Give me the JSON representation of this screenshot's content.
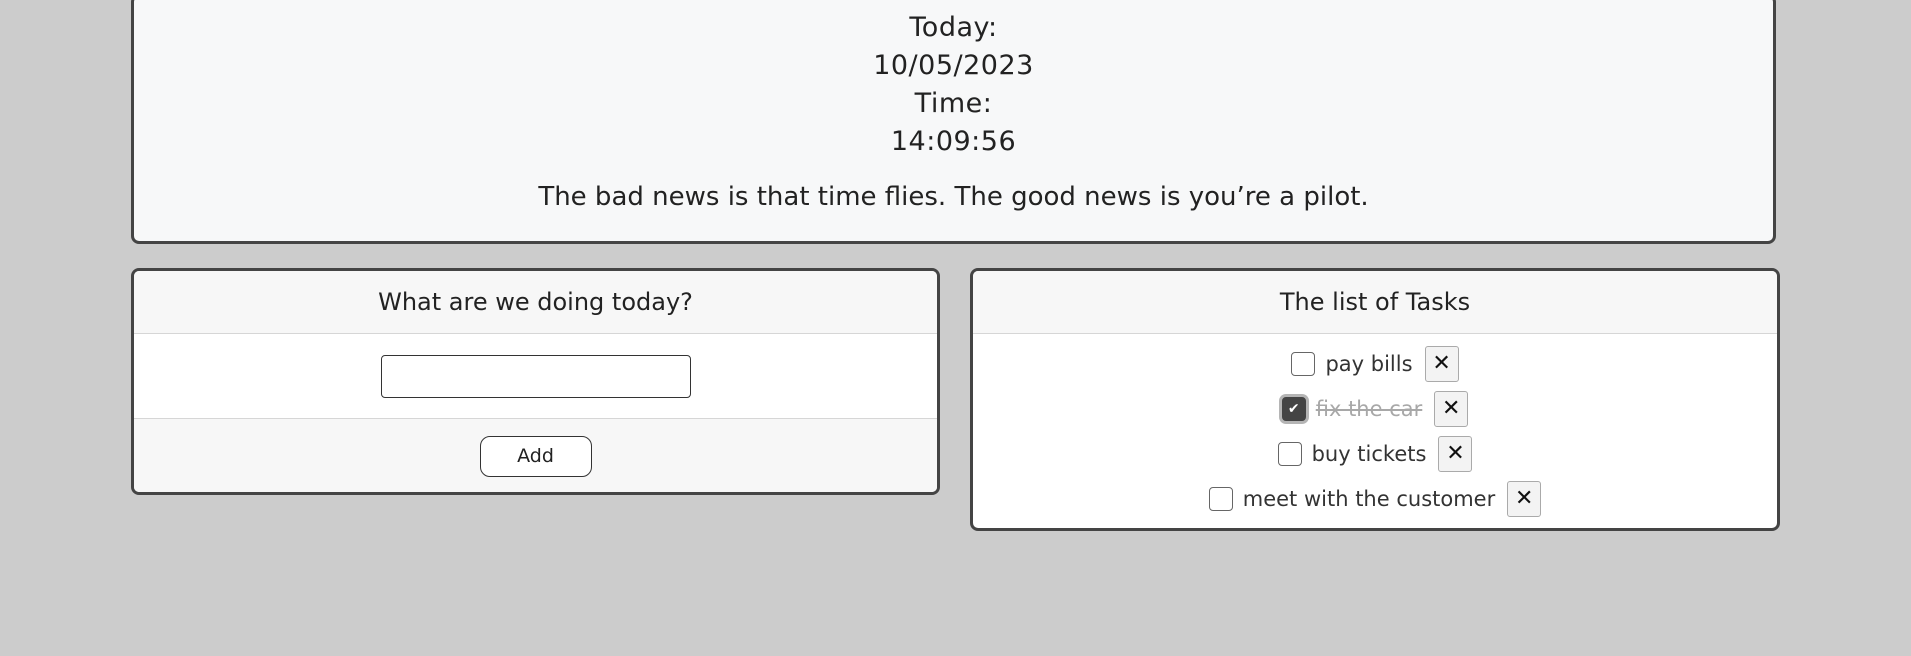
{
  "clock": {
    "date_label": "Today:",
    "date_value": "10/05/2023",
    "time_label": "Time:",
    "time_value": "14:09:56",
    "quote": "The bad news is that time flies. The good news is you’re a pilot."
  },
  "new_task": {
    "heading": "What are we doing today?",
    "input_value": "",
    "add_label": "Add"
  },
  "tasks": {
    "heading": "The list of Tasks",
    "items": [
      {
        "label": "pay bills",
        "done": false
      },
      {
        "label": "fix the car",
        "done": true
      },
      {
        "label": "buy tickets",
        "done": false
      },
      {
        "label": "meet with the customer",
        "done": false
      }
    ],
    "remove_icon": "close-icon",
    "check_icon": "check-icon"
  },
  "glyphs": {
    "close": "✕",
    "check": "✔"
  }
}
